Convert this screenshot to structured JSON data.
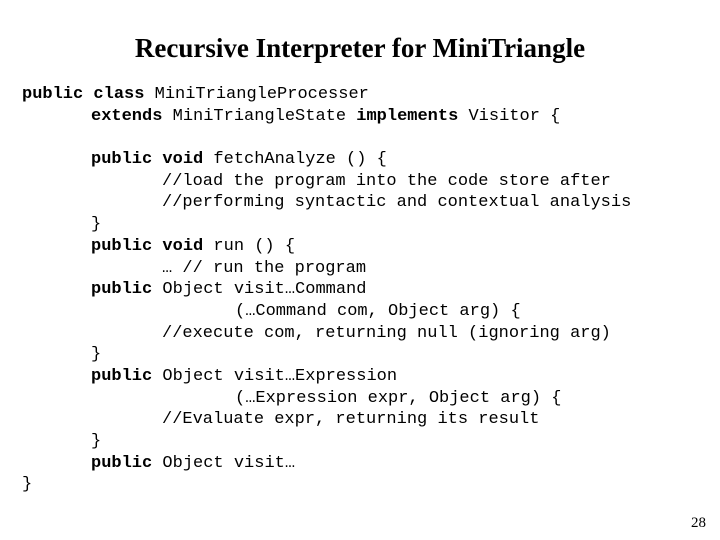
{
  "slide": {
    "title": "Recursive Interpreter for MiniTriangle",
    "page_number": "28",
    "background_color": "#ffffff",
    "text_color": "#000000"
  },
  "code": {
    "language": "java",
    "lines": [
      {
        "indent": 0,
        "bold": "public class ",
        "plain": "MiniTriangleProcesser"
      },
      {
        "indent": 1,
        "bold": "extends ",
        "plain": "MiniTriangleState ",
        "bold2": "implements ",
        "plain2": "Visitor {"
      },
      {
        "indent": 0,
        "bold": "",
        "plain": ""
      },
      {
        "indent": 1,
        "bold": "public void ",
        "plain": "fetchAnalyze () {"
      },
      {
        "indent": 2,
        "bold": "",
        "plain": "//load the program into the code store after"
      },
      {
        "indent": 2,
        "bold": "",
        "plain": "//performing syntactic and contextual analysis"
      },
      {
        "indent": 1,
        "bold": "",
        "plain": "}"
      },
      {
        "indent": 1,
        "bold": "public void ",
        "plain": "run () {"
      },
      {
        "indent": 2,
        "bold": "",
        "plain": "… // run the program"
      },
      {
        "indent": 1,
        "bold": "public ",
        "plain": "Object visit…Command"
      },
      {
        "indent": 3,
        "bold": "",
        "plain": "(…Command com, Object arg) {"
      },
      {
        "indent": 2,
        "bold": "",
        "plain": "//execute com, returning null (ignoring arg)"
      },
      {
        "indent": 1,
        "bold": "",
        "plain": "}"
      },
      {
        "indent": 1,
        "bold": "public ",
        "plain": "Object visit…Expression"
      },
      {
        "indent": 3,
        "bold": "",
        "plain": "(…Expression expr, Object arg) {"
      },
      {
        "indent": 2,
        "bold": "",
        "plain": "//Evaluate expr, returning its result"
      },
      {
        "indent": 1,
        "bold": "",
        "plain": "}"
      },
      {
        "indent": 1,
        "bold": "public ",
        "plain": "Object visit…"
      },
      {
        "indent": 0,
        "bold": "",
        "plain": "}"
      }
    ]
  }
}
